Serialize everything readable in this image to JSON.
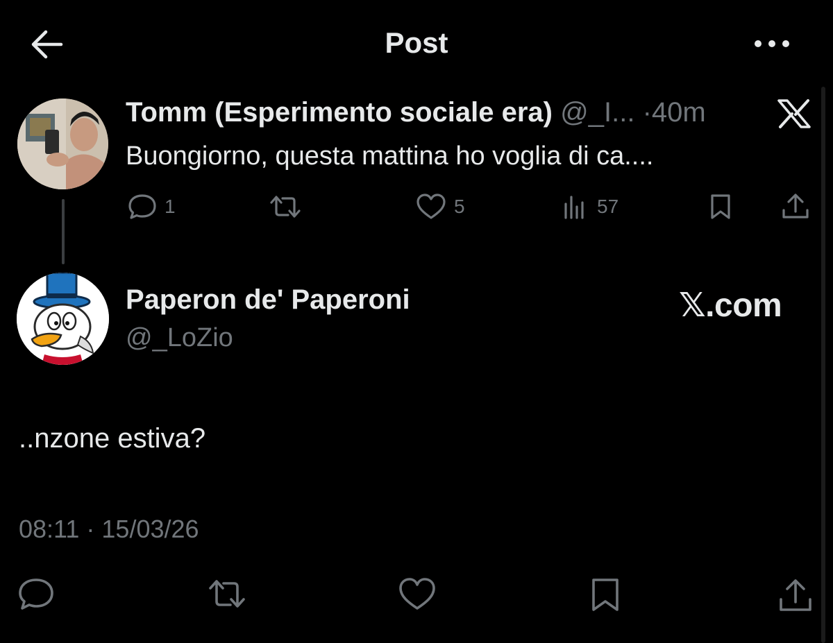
{
  "header": {
    "title": "Post",
    "back_icon": "arrow-left-icon",
    "more_icon": "more-horizontal-icon"
  },
  "parent_post": {
    "author_name": "Tomm (Esperimento sociale era)",
    "handle": "@_I...",
    "separator": "·",
    "time": "40m",
    "text": "Buongiorno, questa mattina ho voglia di ca....",
    "actions": {
      "replies": "1",
      "reposts": "",
      "likes": "5",
      "views": "57"
    }
  },
  "main_post": {
    "author_name": "Paperon de' Paperoni",
    "handle": "@_LoZio",
    "watermark": "𝕏.com",
    "text": "..nzone estiva?",
    "timestamp": "08:11 · 15/03/26"
  },
  "colors": {
    "background": "#000000",
    "text": "#e7e9ea",
    "secondary": "#71767b",
    "avatar_hat": "#1e6fb8"
  }
}
